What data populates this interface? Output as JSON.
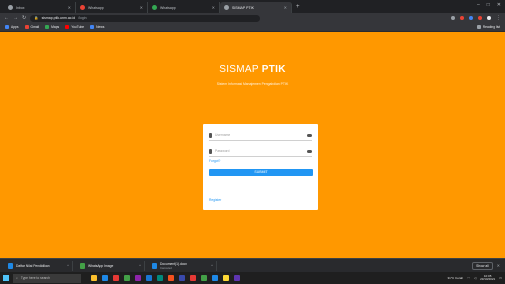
{
  "browser": {
    "tabs": [
      {
        "label": "Inbox",
        "favicon_color": "#9aa0a6",
        "active": false
      },
      {
        "label": "Whatsapp",
        "favicon_color": "#ea4335",
        "active": false
      },
      {
        "label": "Whatsapp",
        "favicon_color": "#34a853",
        "active": false
      },
      {
        "label": "SISMAP PTIK",
        "favicon_color": "#9aa0a6",
        "active": true
      }
    ],
    "new_tab": "+",
    "url": "sismap.ptik.unm.ac.id",
    "url_path": "/login",
    "bookmarks": [
      {
        "label": "Apps",
        "color": "#4285f4"
      },
      {
        "label": "Gmail",
        "color": "#ea4335"
      },
      {
        "label": "Maps",
        "color": "#34a853"
      },
      {
        "label": "YouTube",
        "color": "#ff0000"
      },
      {
        "label": "News",
        "color": "#4285f4"
      }
    ],
    "reading_list": "Reading list"
  },
  "login": {
    "app_name_part1": "SISMAP",
    "app_name_part2": "PTIK",
    "subtitle": "Sistem Informasi Manajemen Pengabdian PTIK",
    "username_placeholder": "Username",
    "password_placeholder": "Password",
    "forgot": "Forgot?",
    "submit_label": "SUBMIT",
    "bottom_link": "Register"
  },
  "downloads": {
    "items": [
      {
        "name": "Daftar Nilai Pendidikan",
        "sub": "",
        "color": "#1e88e5"
      },
      {
        "name": "WhatsApp Image",
        "sub": "",
        "color": "#43a047"
      },
      {
        "name": "Document(1).docx",
        "sub": "Canceled",
        "color": "#1e88e5"
      }
    ],
    "show_all": "Show all",
    "close": "✕"
  },
  "taskbar": {
    "search_placeholder": "Type here to search",
    "app_icons": [
      "#fbc02d",
      "#1e88e5",
      "#e53935",
      "#43a047",
      "#8e24aa",
      "#1976d2",
      "#00897b",
      "#f4511e",
      "#3949ab",
      "#e53935",
      "#43a047",
      "#1e88e5",
      "#fdd835",
      "#5e35b1"
    ],
    "weather": "31°C Cerah",
    "time": "10:05",
    "date": "23/10/2021"
  }
}
